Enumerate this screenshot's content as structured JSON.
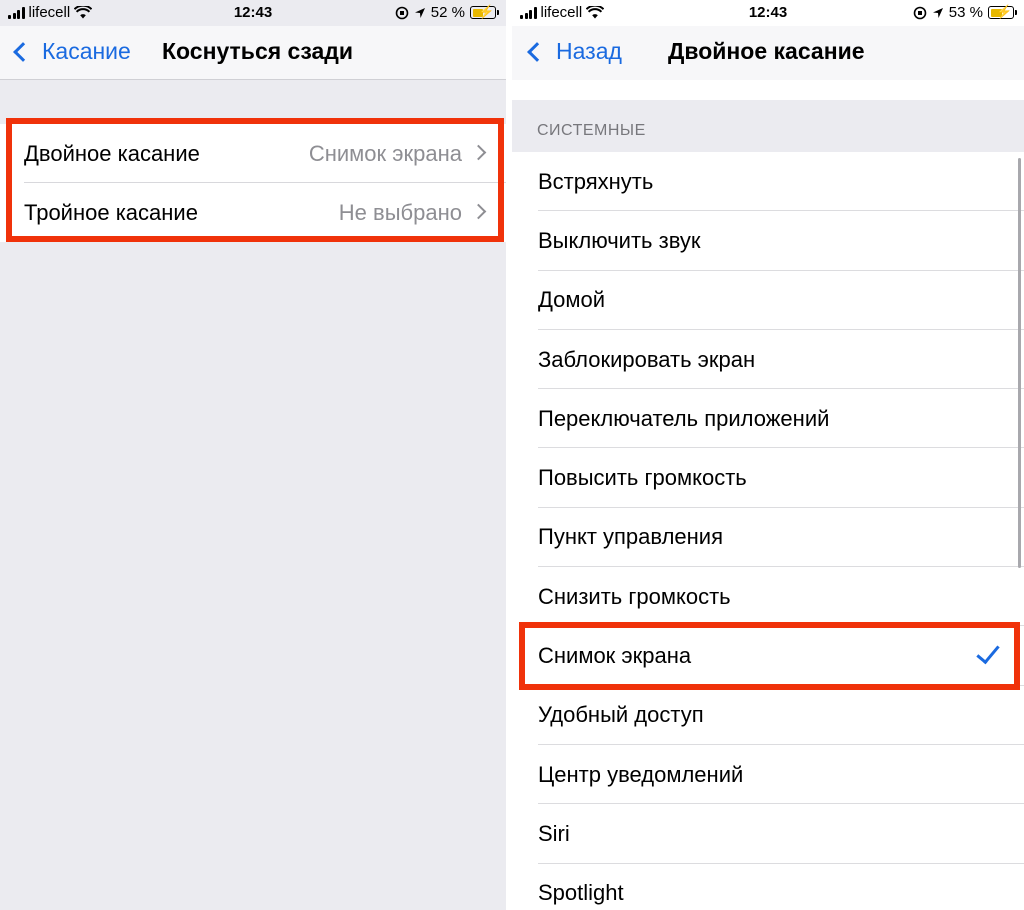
{
  "left": {
    "status": {
      "carrier": "lifecell",
      "time": "12:43",
      "battery": "52 %"
    },
    "nav": {
      "back_label": "Касание",
      "title": "Коснуться сзади"
    },
    "rows": [
      {
        "label": "Двойное касание",
        "value": "Снимок экрана"
      },
      {
        "label": "Тройное касание",
        "value": "Не выбрано"
      }
    ]
  },
  "right": {
    "status": {
      "carrier": "lifecell",
      "time": "12:43",
      "battery": "53 %"
    },
    "nav": {
      "back_label": "Назад",
      "title": "Двойное касание"
    },
    "section_header": "СИСТЕМНЫЕ",
    "items": [
      {
        "label": "Встряхнуть"
      },
      {
        "label": "Выключить звук"
      },
      {
        "label": "Домой"
      },
      {
        "label": "Заблокировать экран"
      },
      {
        "label": "Переключатель приложений"
      },
      {
        "label": "Повысить громкость"
      },
      {
        "label": "Пункт управления"
      },
      {
        "label": "Снизить громкость"
      },
      {
        "label": "Снимок экрана",
        "selected": true
      },
      {
        "label": "Удобный доступ"
      },
      {
        "label": "Центр уведомлений"
      },
      {
        "label": "Siri"
      },
      {
        "label": "Spotlight"
      }
    ]
  },
  "colors": {
    "accent": "#1a6ae0",
    "highlight": "#f0320a",
    "background": "#ebebf0"
  }
}
